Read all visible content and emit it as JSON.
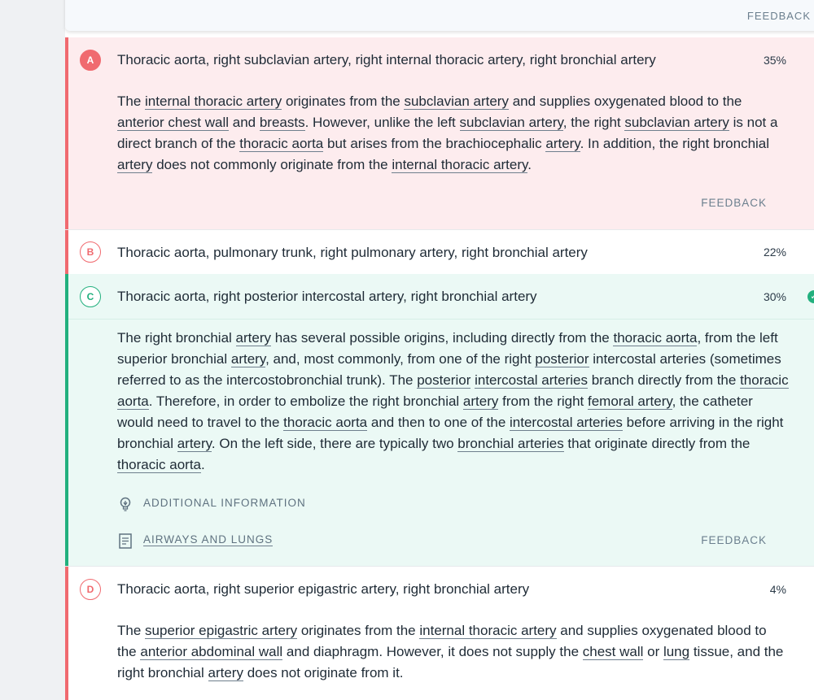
{
  "colors": {
    "incorrect_bg": "#fdecee",
    "incorrect_bar": "#f06a6f",
    "correct_bg": "#ebf9f5",
    "correct_bar": "#22b07e",
    "page_bg": "#eff1f3"
  },
  "header": {
    "feedback_label": "FEEDBACK"
  },
  "choices": [
    {
      "letter": "A",
      "text": "Thoracic aorta, right subclavian artery, right internal thoracic artery, right bronchial artery",
      "percent": "35%",
      "state": "incorrect",
      "feedback_label": "FEEDBACK"
    },
    {
      "letter": "B",
      "text": "Thoracic aorta, pulmonary trunk, right pulmonary artery, right bronchial artery",
      "percent": "22%",
      "state": "incorrect"
    },
    {
      "letter": "C",
      "text": "Thoracic aorta, right posterior intercostal artery, right bronchial artery",
      "percent": "30%",
      "state": "correct",
      "check_icon": "check-circle-icon",
      "additional_info_label": "ADDITIONAL INFORMATION",
      "related_link_label": "AIRWAYS AND LUNGS",
      "feedback_label": "FEEDBACK"
    },
    {
      "letter": "D",
      "text": "Thoracic aorta, right superior epigastric artery, right bronchial artery",
      "percent": "4%",
      "state": "incorrect"
    }
  ],
  "explanations": {
    "a": {
      "t0": "The ",
      "l0": "internal thoracic artery",
      "t1": " originates from the ",
      "l1": "subclavian artery",
      "t2": " and supplies oxygenated blood to the ",
      "l2": "anterior chest wall",
      "t3": " and ",
      "l3": "breasts",
      "t4": ". However, unlike the left ",
      "l4": "subclavian artery",
      "t5": ", the right ",
      "l5": "subclavian artery",
      "t6": " is not a direct branch of the ",
      "l6": "thoracic aorta",
      "t7": " but arises from the brachiocephalic ",
      "l7": "artery",
      "t8": ". In addition, the right bronchial ",
      "l8": "artery",
      "t9": " does not commonly originate from the ",
      "l9": "internal thoracic artery",
      "t10": "."
    },
    "c": {
      "t0": "The right bronchial ",
      "l0": "artery",
      "t1": " has several possible origins, including directly from the ",
      "l1": "thoracic aorta",
      "t2": ", from the left superior bronchial ",
      "l2": "artery",
      "t3": ", and, most commonly, from one of the right ",
      "l3": "posterior",
      "t4": " intercostal arteries (sometimes referred to as the intercostobronchial trunk). The ",
      "l4": "posterior",
      "t5": " ",
      "l5": "intercostal arteries",
      "t6": " branch directly from the ",
      "l6": "thoracic aorta",
      "t7": ". Therefore, in order to embolize the right bronchial ",
      "l7": "artery",
      "t8": " from the right ",
      "l8": "femoral artery",
      "t9": ", the catheter would need to travel to the ",
      "l9": "thoracic aorta",
      "t10": " and then to one of the ",
      "l10": "intercostal arteries",
      "t11": " before arriving in the right bronchial ",
      "l11": "artery",
      "t12": ". On the left side, there are typically two ",
      "l12": "bronchial arteries",
      "t13": " that originate directly from the ",
      "l13": "thoracic aorta",
      "t14": "."
    },
    "d": {
      "t0": "The ",
      "l0": "superior epigastric artery",
      "t1": " originates from the ",
      "l1": "internal thoracic artery",
      "t2": " and supplies oxygenated blood to the ",
      "l2": "anterior abdominal wall",
      "t3": " and diaphragm. However, it does not supply the ",
      "l3": "chest wall",
      "t4": " or ",
      "l4": "lung",
      "t5": " tissue, and the right bronchial ",
      "l5": "artery",
      "t6": " does not originate from it."
    }
  }
}
